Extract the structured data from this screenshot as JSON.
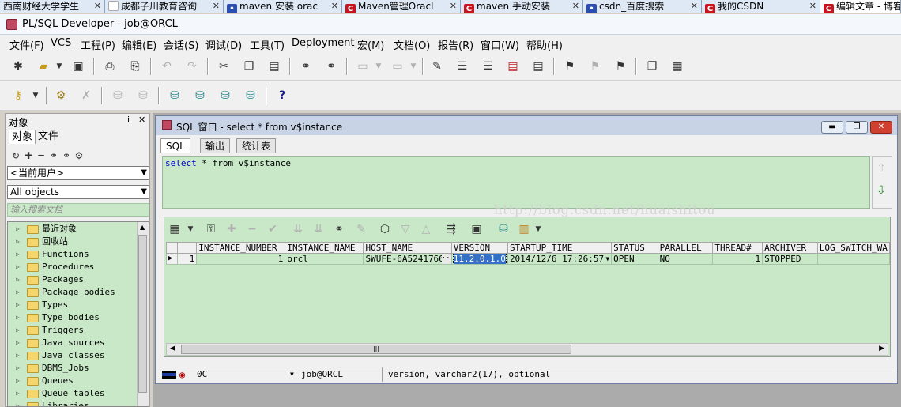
{
  "browser_tabs": [
    {
      "label": "西南财经大学学生",
      "fav": "",
      "fav_color": "#3a5fa0"
    },
    {
      "label": "成都子川教育咨询",
      "fav": "",
      "fav_color": "#ffffff"
    },
    {
      "label": "maven 安装 orac",
      "fav": "🐾",
      "fav_color": "#2a4fb0"
    },
    {
      "label": "Maven管理Oracl",
      "fav": "C",
      "fav_color": "#c8141e"
    },
    {
      "label": "maven 手动安装",
      "fav": "C",
      "fav_color": "#c8141e"
    },
    {
      "label": "csdn_百度搜索",
      "fav": "🐾",
      "fav_color": "#2a4fb0"
    },
    {
      "label": "我的CSDN",
      "fav": "C",
      "fav_color": "#c8141e"
    },
    {
      "label": "编辑文章 - 博客",
      "fav": "C",
      "fav_color": "#c8141e"
    }
  ],
  "window_title": "PL/SQL Developer - job@ORCL",
  "menu": [
    "文件(F)",
    "VCS",
    "工程(P)",
    "编辑(E)",
    "会话(S)",
    "调试(D)",
    "工具(T)",
    "Deployment",
    "宏(M)",
    "文档(O)",
    "报告(R)",
    "窗口(W)",
    "帮助(H)"
  ],
  "object_panel": {
    "title": "对象",
    "pin": "ⅱ",
    "close": "✕",
    "tabs": [
      "对象",
      "文件"
    ],
    "user_combo": "<当前用户>",
    "type_combo": "All objects",
    "filter_placeholder": "输入搜索文档",
    "tree": [
      "最近对象",
      "回收站",
      "Functions",
      "Procedures",
      "Packages",
      "Package bodies",
      "Types",
      "Type bodies",
      "Triggers",
      "Java sources",
      "Java classes",
      "DBMS_Jobs",
      "Queues",
      "Queue tables",
      "Libraries"
    ]
  },
  "sql_window": {
    "title": "SQL 窗口 - select * from v$instance",
    "tabs": [
      "SQL",
      "输出",
      "统计表"
    ],
    "query_kw": "select",
    "query_rest": " * from v$instance",
    "watermark": "http://blog.csdn.net/huaishitou",
    "columns": [
      "",
      "",
      "INSTANCE_NUMBER",
      "INSTANCE_NAME",
      "HOST_NAME",
      "VERSION",
      "STARTUP_TIME",
      "STATUS",
      "PARALLEL",
      "THREAD#",
      "ARCHIVER",
      "LOG_SWITCH_WA"
    ],
    "row": {
      "marker": "▶",
      "num": "1",
      "instance_number": "1",
      "instance_name": "orcl",
      "host_name": "SWUFE-6A5241766",
      "host_ellipsis": "···",
      "version": "11.2.0.1.0",
      "startup_time": "2014/12/6 17:26:57",
      "status": "OPEN",
      "parallel": "NO",
      "thread": "1",
      "archiver": "STOPPED",
      "log_switch_wait": ""
    },
    "status_bar": {
      "state": "0C",
      "connection": "job@ORCL",
      "column_info": "version, varchar2(17), optional"
    }
  }
}
